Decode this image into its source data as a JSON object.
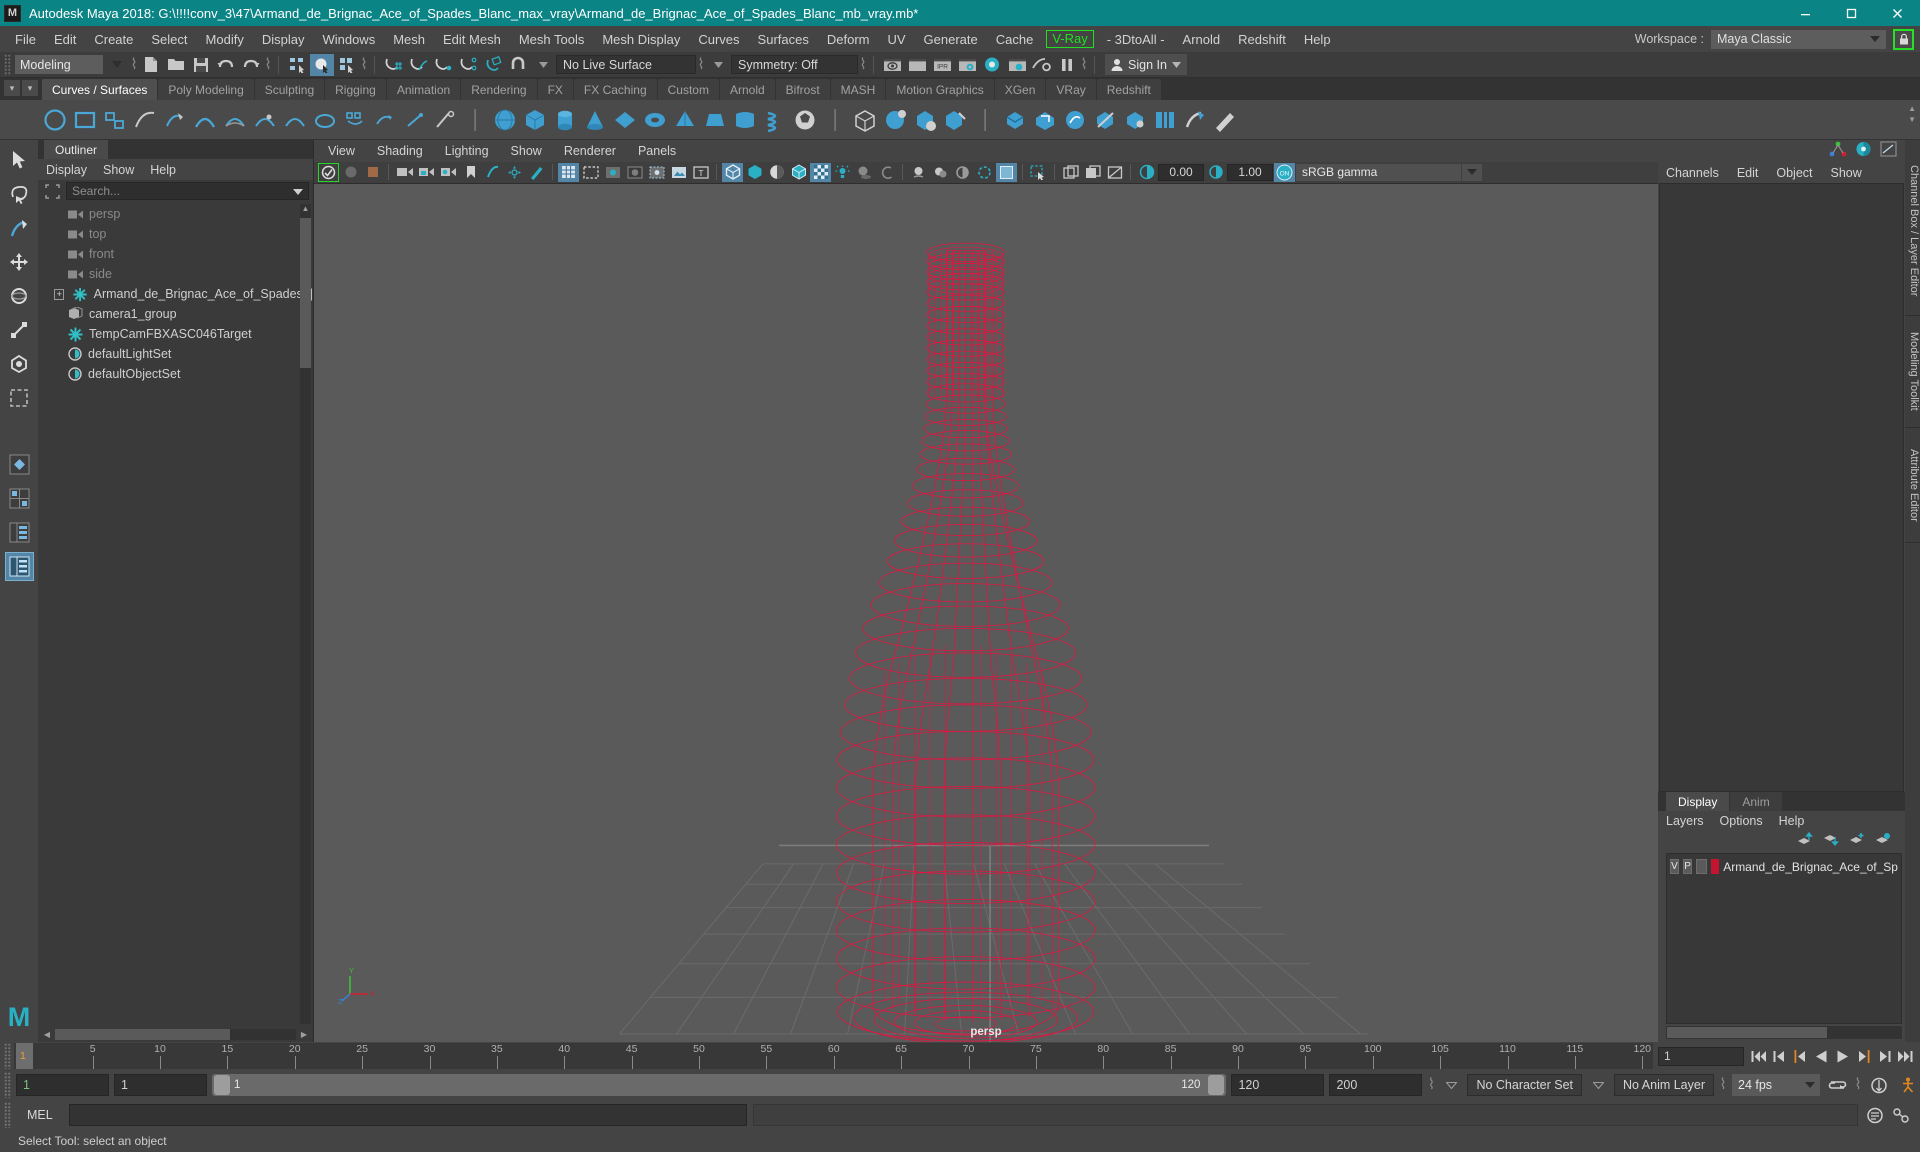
{
  "titlebar": {
    "logo": "M",
    "title": "Autodesk Maya 2018: G:\\!!!!conv_3\\47\\Armand_de_Brignac_Ace_of_Spades_Blanc_max_vray\\Armand_de_Brignac_Ace_of_Spades_Blanc_mb_vray.mb*",
    "minimize": "minimize-icon",
    "maximize": "maximize-icon",
    "close": "close-icon",
    "bg_color": "#0b8486"
  },
  "menubar": {
    "items": [
      {
        "label": "File"
      },
      {
        "label": "Edit"
      },
      {
        "label": "Create"
      },
      {
        "label": "Select"
      },
      {
        "label": "Modify"
      },
      {
        "label": "Display"
      },
      {
        "label": "Windows"
      },
      {
        "label": "Mesh"
      },
      {
        "label": "Edit Mesh"
      },
      {
        "label": "Mesh Tools"
      },
      {
        "label": "Mesh Display"
      },
      {
        "label": "Curves"
      },
      {
        "label": "Surfaces"
      },
      {
        "label": "Deform"
      },
      {
        "label": "UV"
      },
      {
        "label": "Generate"
      },
      {
        "label": "Cache"
      },
      {
        "label": "V-Ray",
        "highlight": true
      },
      {
        "label": "- 3DtoAll -"
      },
      {
        "label": "Arnold"
      },
      {
        "label": "Redshift"
      },
      {
        "label": "Help"
      }
    ],
    "vray_color": "#20e020",
    "workspace_label": "Workspace :",
    "workspace_value": "Maya Classic",
    "lock_icon": "lock-icon",
    "lock_color": "#25e025"
  },
  "toolbar": {
    "mode_value": "Modeling",
    "live_surface": "No Live Surface",
    "symmetry": "Symmetry: Off",
    "signin": "Sign In",
    "icons": [
      "new-scene-icon",
      "open-scene-icon",
      "save-scene-icon",
      "undo-icon",
      "redo-icon",
      "select-by-hierarchy-icon",
      "select-by-object-icon",
      "select-by-component-icon",
      "snap-to-grid-icon",
      "snap-to-curve-icon",
      "snap-to-point-icon",
      "snap-to-projected-center-icon",
      "snap-to-view-plane-icon",
      "magnet-icon",
      "render-current-frame-icon",
      "ipr-render-icon",
      "render-settings-icon",
      "hypershade-icon",
      "render-view-icon",
      "render-setup-icon",
      "pause-icon"
    ]
  },
  "shelf": {
    "tabs": [
      {
        "label": "Curves / Surfaces",
        "active": true
      },
      {
        "label": "Poly Modeling"
      },
      {
        "label": "Sculpting"
      },
      {
        "label": "Rigging"
      },
      {
        "label": "Animation"
      },
      {
        "label": "Rendering"
      },
      {
        "label": "FX"
      },
      {
        "label": "FX Caching"
      },
      {
        "label": "Custom"
      },
      {
        "label": "Arnold"
      },
      {
        "label": "Bifrost"
      },
      {
        "label": "MASH"
      },
      {
        "label": "Motion Graphics"
      },
      {
        "label": "XGen"
      },
      {
        "label": "VRay"
      },
      {
        "label": "Redshift"
      }
    ]
  },
  "toolbox": {
    "tools": [
      {
        "name": "select-tool",
        "selected": false
      },
      {
        "name": "lasso-select-tool",
        "selected": false
      },
      {
        "name": "paint-select-tool",
        "selected": false
      },
      {
        "name": "move-tool",
        "selected": false
      },
      {
        "name": "rotate-tool",
        "selected": false
      },
      {
        "name": "scale-tool",
        "selected": false
      },
      {
        "name": "soft-modification-tool",
        "selected": false
      },
      {
        "name": "last-tool-used",
        "selected": false
      },
      {
        "name": "single-perspective-layout",
        "selected": false
      },
      {
        "name": "four-view-layout",
        "selected": false
      },
      {
        "name": "persp-outliner-layout",
        "selected": false
      },
      {
        "name": "persp-graph-layout",
        "selected": true
      }
    ],
    "logo": "M"
  },
  "outliner": {
    "tab": "Outliner",
    "menu": [
      "Display",
      "Show",
      "Help"
    ],
    "search_placeholder": "Search...",
    "items": [
      {
        "label": "persp",
        "icon": "camera-icon",
        "dim": true,
        "indent": 1
      },
      {
        "label": "top",
        "icon": "camera-icon",
        "dim": true,
        "indent": 1
      },
      {
        "label": "front",
        "icon": "camera-icon",
        "dim": true,
        "indent": 1
      },
      {
        "label": "side",
        "icon": "camera-icon",
        "dim": true,
        "indent": 1
      },
      {
        "label": "Armand_de_Brignac_Ace_of_Spades_|",
        "icon": "transform-icon",
        "dim": false,
        "indent": 0,
        "expand": "+"
      },
      {
        "label": "camera1_group",
        "icon": "group-icon",
        "dim": false,
        "indent": 1
      },
      {
        "label": "TempCamFBXASC046Target",
        "icon": "transform-icon",
        "dim": false,
        "indent": 1
      },
      {
        "label": "defaultLightSet",
        "icon": "set-icon",
        "dim": false,
        "indent": 1
      },
      {
        "label": "defaultObjectSet",
        "icon": "set-icon",
        "dim": false,
        "indent": 1
      }
    ]
  },
  "viewport": {
    "menu": [
      "View",
      "Shading",
      "Lighting",
      "Show",
      "Renderer",
      "Panels"
    ],
    "camera_label": "persp",
    "exposure": "0.00",
    "gamma": "1.00",
    "color_management": "sRGB gamma",
    "bg_color": "#5a5a5a",
    "wireframe_color": "#e8123f",
    "grid_color": "#6e6e6e",
    "axis": {
      "x": "X",
      "y": "Y",
      "z": "Z"
    }
  },
  "channelbox": {
    "menu": [
      "Channels",
      "Edit",
      "Object",
      "Show"
    ],
    "side_tabs": [
      "Channel Box / Layer Editor",
      "Modeling Toolkit",
      "Attribute Editor"
    ]
  },
  "layereditor": {
    "tabs": [
      {
        "label": "Display",
        "active": true
      },
      {
        "label": "Anim",
        "active": false
      }
    ],
    "menu": [
      "Layers",
      "Options",
      "Help"
    ],
    "layers": [
      {
        "visible": "V",
        "playback": "P",
        "color": "#c4152f",
        "name": "Armand_de_Brignac_Ace_of_Sp"
      }
    ]
  },
  "timeline": {
    "ticks": [
      5,
      10,
      15,
      20,
      25,
      30,
      35,
      40,
      45,
      50,
      55,
      60,
      65,
      70,
      75,
      80,
      85,
      90,
      95,
      100,
      105,
      110,
      115,
      120
    ],
    "start": 1,
    "end": 120,
    "current_frame": "1",
    "current_frame_field": "1",
    "playback_buttons": [
      "go-to-start-icon",
      "step-back-keyframe-icon",
      "step-back-frame-icon",
      "play-backwards-icon",
      "play-forwards-icon",
      "step-forward-frame-icon",
      "step-forward-keyframe-icon",
      "go-to-end-icon"
    ]
  },
  "rangeslider": {
    "anim_start": "1",
    "range_start": "1",
    "slider_min_label": "1",
    "slider_max_label": "120",
    "range_end": "120",
    "anim_end": "200",
    "character_set": "No Character Set",
    "anim_layer": "No Anim Layer",
    "fps": "24 fps",
    "icons": [
      "loop-playback-icon",
      "auto-keyframe-icon",
      "animation-preferences-icon"
    ]
  },
  "melbar": {
    "label": "MEL",
    "input_value": "",
    "command_value": "",
    "icons": [
      "script-editor-icon",
      "command-help-icon"
    ]
  },
  "statusbar": {
    "message": "Select Tool: select an object"
  }
}
